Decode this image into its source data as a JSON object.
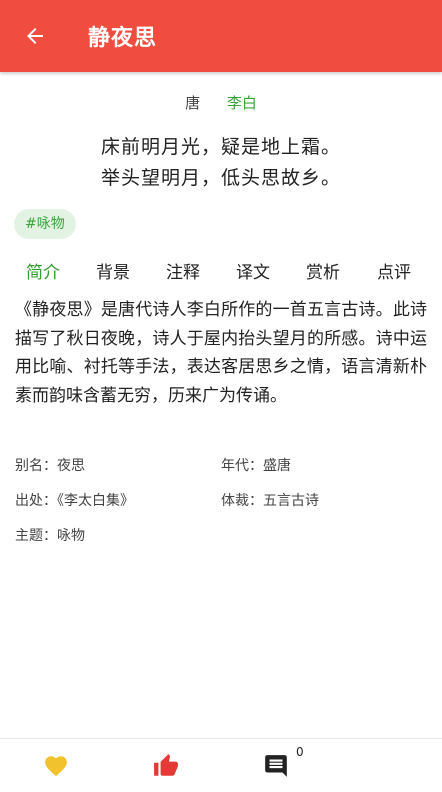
{
  "appbar": {
    "title": "静夜思"
  },
  "poem_meta": {
    "dynasty": "唐",
    "author": "李白"
  },
  "poem": {
    "lines": [
      "床前明月光，疑是地上霜。",
      "举头望明月，低头思故乡。"
    ]
  },
  "tag": "#咏物",
  "tabs": [
    "简介",
    "背景",
    "注释",
    "译文",
    "赏析",
    "点评"
  ],
  "intro": "《静夜思》是唐代诗人李白所作的一首五言古诗。此诗描写了秋日夜晚，诗人于屋内抬头望月的所感。诗中运用比喻、衬托等手法，表达客居思乡之情，语言清新朴素而韵味含蓄无穷，历来广为传诵。",
  "info": {
    "alias": "别名：夜思",
    "era": "年代：盛唐",
    "source": "出处：《李太白集》",
    "genre": "体裁：五言古诗",
    "theme": "主题：咏物"
  },
  "bottom": {
    "comment_count": "0"
  },
  "colors": {
    "appbar": "#f04c3f",
    "accent_green": "#3aa43a",
    "heart": "#f2c12e",
    "like": "#e53935"
  }
}
